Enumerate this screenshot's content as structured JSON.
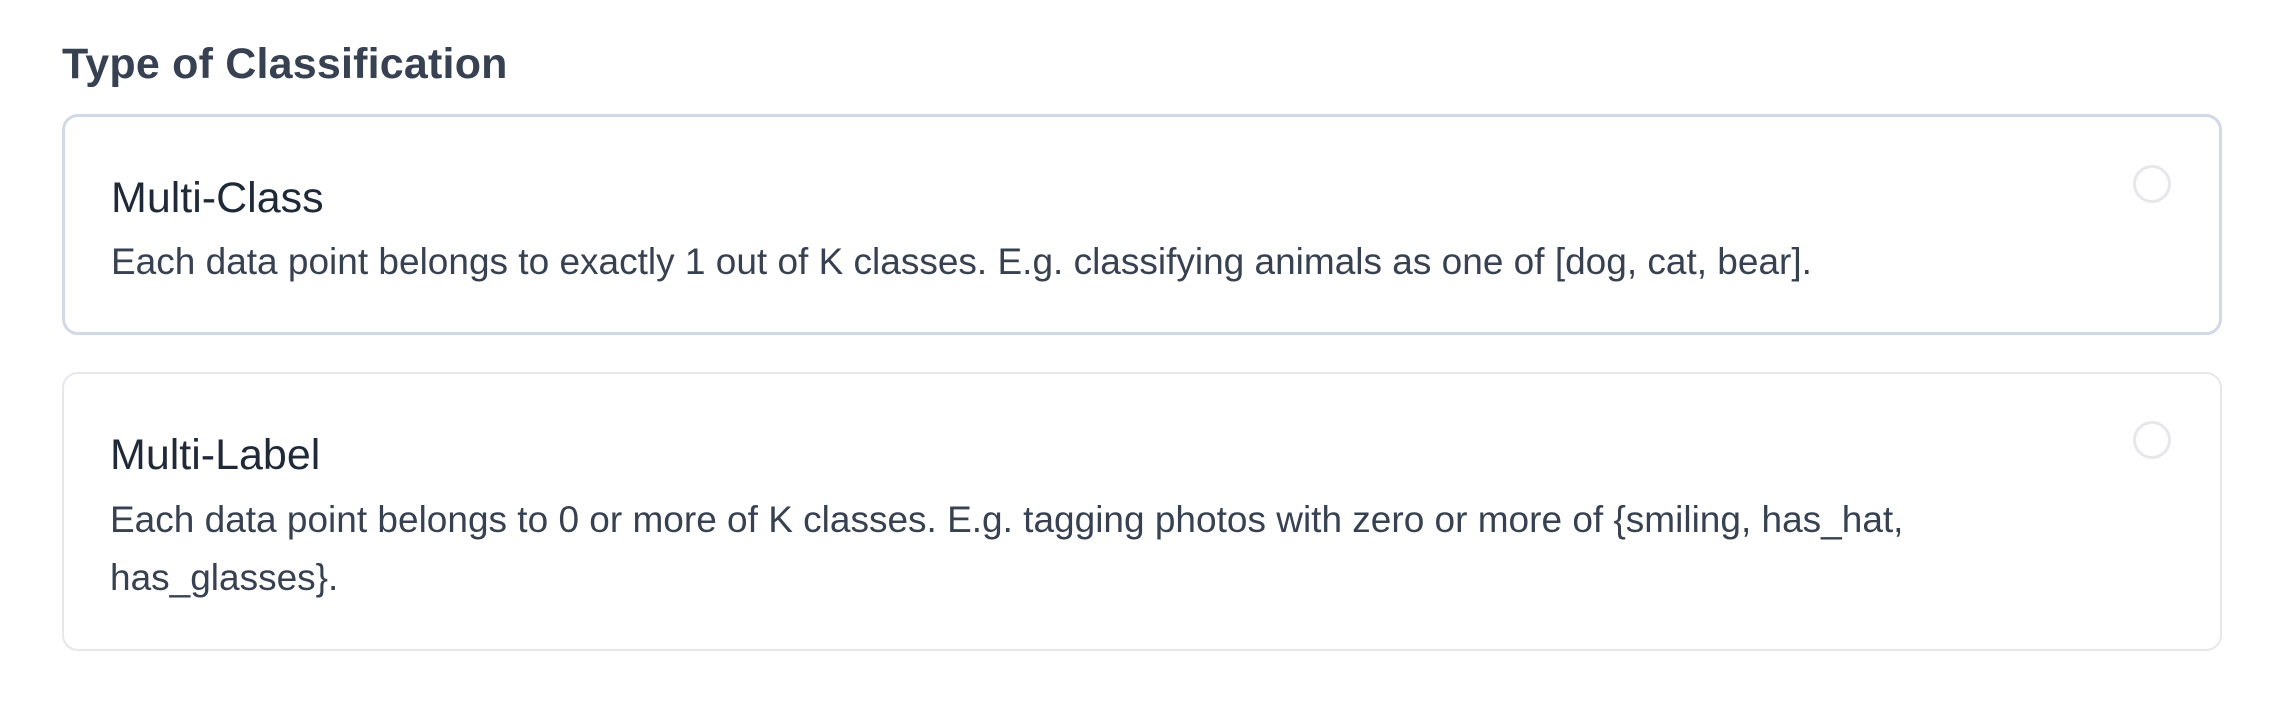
{
  "section": {
    "title": "Type of Classification"
  },
  "options": [
    {
      "title": "Multi-Class",
      "description": "Each data point belongs to exactly 1 out of K classes. E.g. classifying animals as one of [dog, cat, bear].",
      "selected": false
    },
    {
      "title": "Multi-Label",
      "description": "Each data point belongs to 0 or more of K classes. E.g. tagging photos with zero or more of {smiling, has_hat, has_glasses}.",
      "selected": false
    }
  ],
  "colors": {
    "text_heading": "#374151",
    "text_title": "#1f2937",
    "card_border": "#e5e7eb",
    "card_border_focused": "#d1d9e6",
    "radio_border": "#e5e7eb"
  },
  "icons": {
    "radio": "radio-unselected-icon"
  }
}
